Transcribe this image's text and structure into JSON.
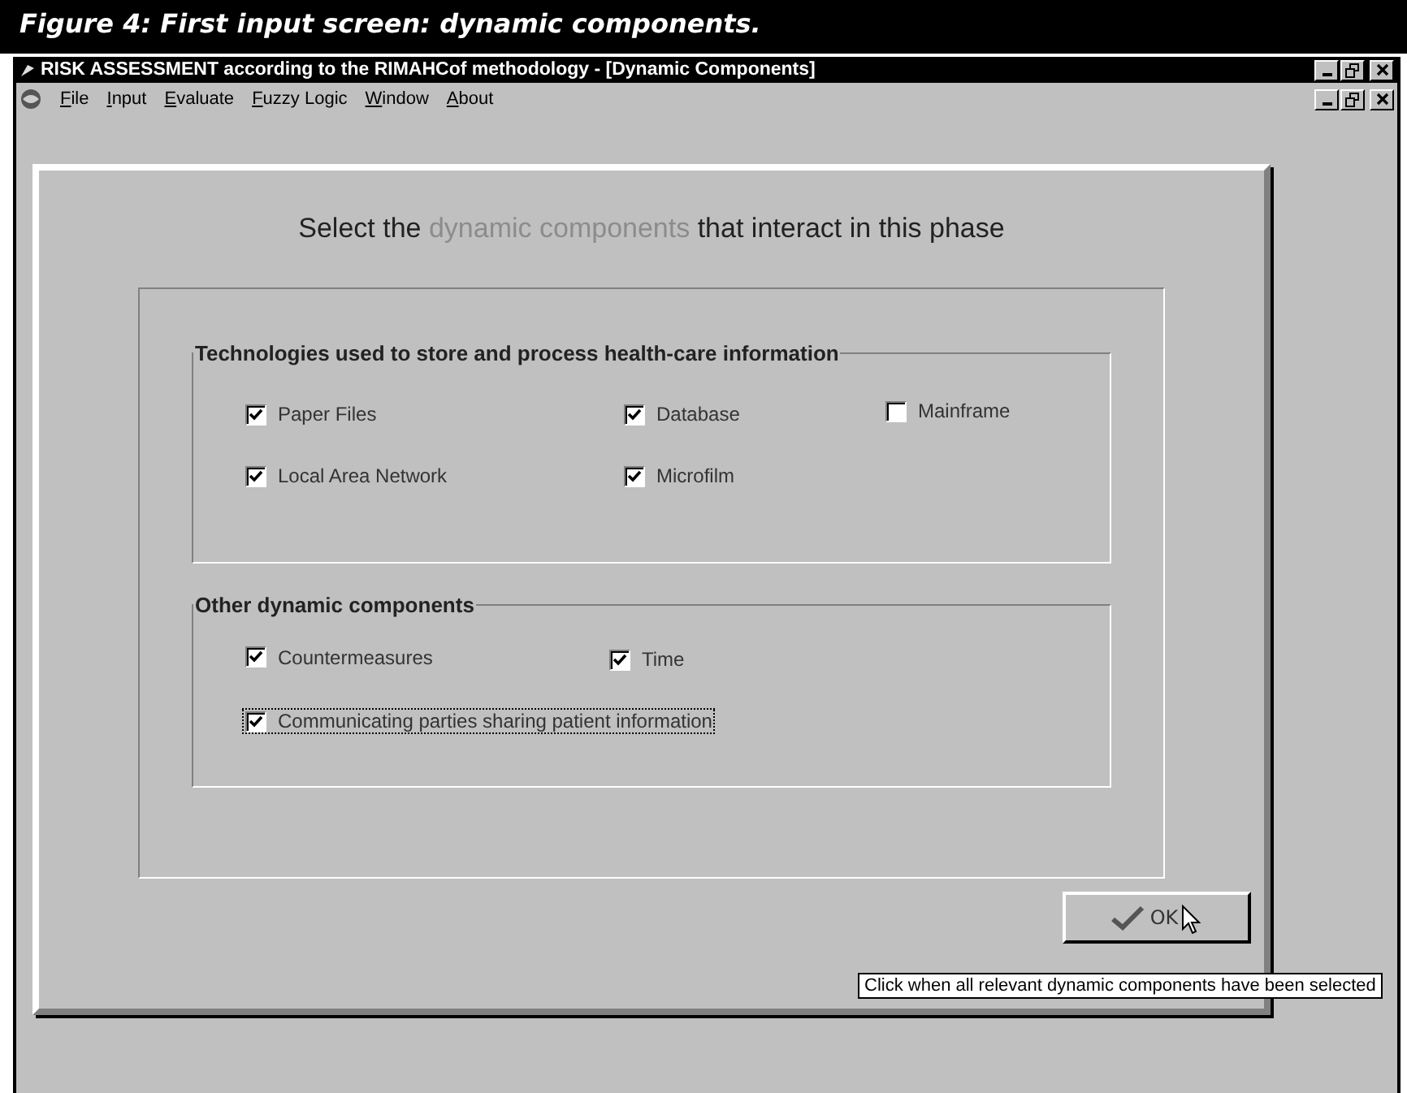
{
  "caption": "Figure 4: First input screen: dynamic components.",
  "window": {
    "title": "RISK ASSESSMENT according to the RIMAHCof methodology - [Dynamic Components]"
  },
  "menu": [
    "File",
    "Input",
    "Evaluate",
    "Fuzzy Logic",
    "Window",
    "About"
  ],
  "heading": {
    "before": "Select the",
    "highlight": "dynamic components",
    "after": "that interact in this phase"
  },
  "groups": [
    {
      "title": "Technologies used to store and process health-care information",
      "items": [
        {
          "label": "Paper Files",
          "checked": true,
          "focused": false
        },
        {
          "label": "Database",
          "checked": true,
          "focused": false
        },
        {
          "label": "Mainframe",
          "checked": false,
          "focused": false
        },
        {
          "label": "Local Area Network",
          "checked": true,
          "focused": false
        },
        {
          "label": "Microfilm",
          "checked": true,
          "focused": false
        }
      ]
    },
    {
      "title": "Other dynamic components",
      "items": [
        {
          "label": "Countermeasures",
          "checked": true,
          "focused": false
        },
        {
          "label": "Time",
          "checked": true,
          "focused": false
        },
        {
          "label": "Communicating parties sharing patient information",
          "checked": true,
          "focused": true
        }
      ]
    }
  ],
  "ok_button": "OK",
  "tooltip": "Click when all relevant dynamic components have been selected"
}
